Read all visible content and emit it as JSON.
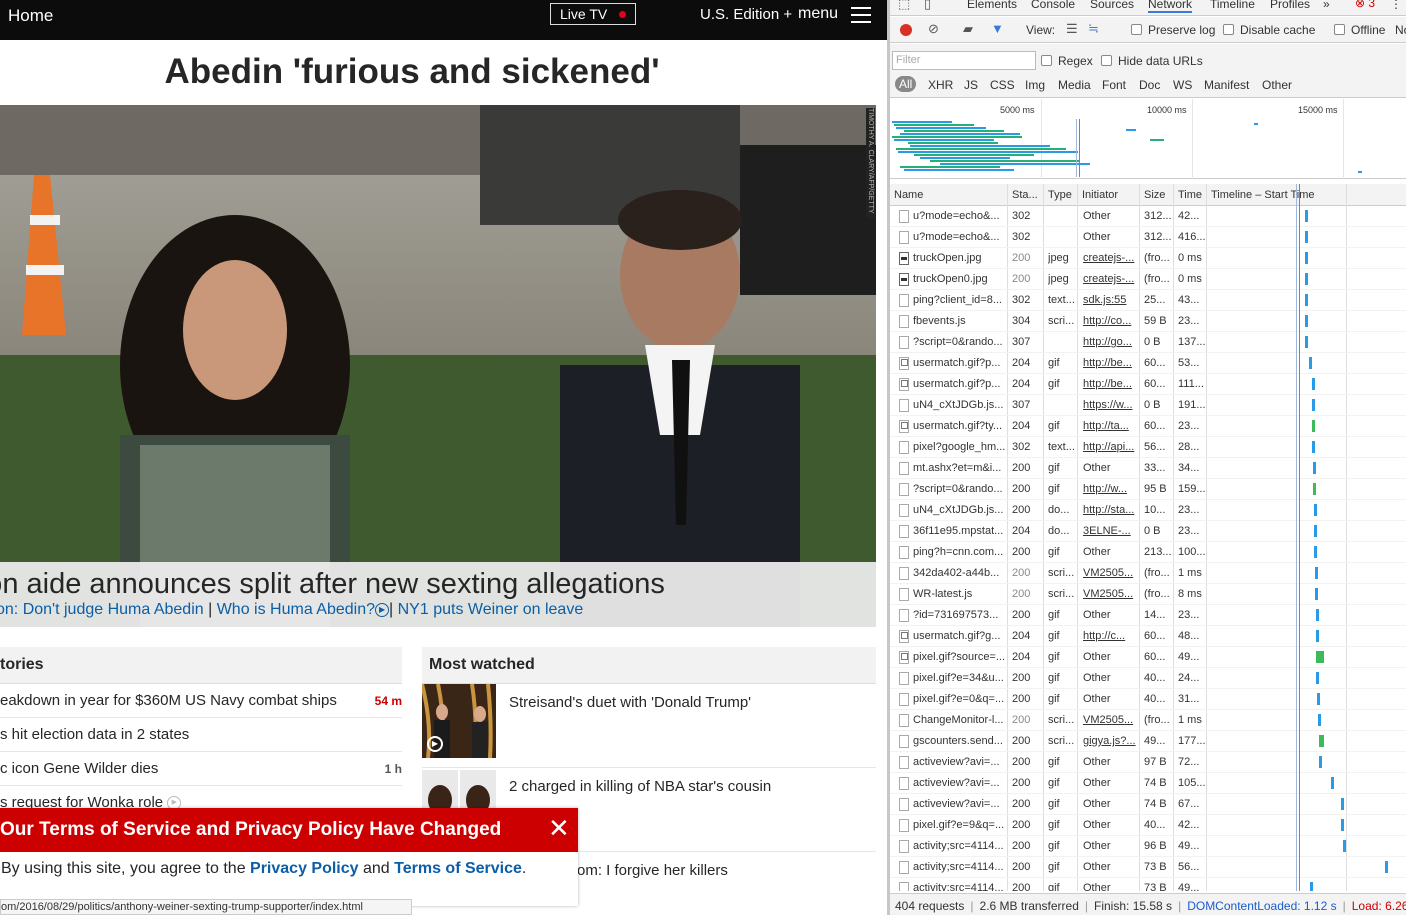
{
  "cnn": {
    "nav": {
      "home": "Home",
      "live_tv": "Live TV",
      "edition": "U.S. Edition",
      "plus": "+",
      "menu": "menu"
    },
    "headline": "Abedin 'furious and sickened'",
    "photo_credit": "TIMOTHY A. CLARY/AFP/GETTY IMAGES",
    "caption": {
      "title": "nton aide announces split after new sexting allegations",
      "link1": "on: Don't judge Huma Abedin",
      "link2": "Who is Huma Abedin?",
      "link3": "NY1 puts Weiner on leave",
      "sep": "|"
    },
    "top_stories": {
      "title": "tories",
      "items": [
        {
          "text": "eakdown in year for $360M US Navy combat ships",
          "time": "54 m"
        },
        {
          "text": "s hit election data in 2 states",
          "time": ""
        },
        {
          "text": "c icon Gene Wilder dies",
          "time": "1 h"
        },
        {
          "text": "s request for Wonka role",
          "time": ""
        }
      ]
    },
    "most_watched": {
      "title": "Most watched",
      "items": [
        {
          "text": "Streisand's duet with 'Donald Trump'"
        },
        {
          "text": "2 charged in killing of NBA star's cousin"
        },
        {
          "text": "om: I forgive her killers"
        }
      ]
    },
    "tos": {
      "title": "Our Terms of Service and Privacy Policy Have Changed",
      "body_prefix": "By using this site, you agree to the ",
      "privacy": "Privacy Policy",
      "and": " and ",
      "terms": "Terms of Service",
      "suffix": ".",
      "close": "✕"
    },
    "status_url": "om/2016/08/29/politics/anthony-weiner-sexting-trump-supporter/index.html"
  },
  "devtools": {
    "tabs": [
      "Elements",
      "Console",
      "Sources",
      "Network",
      "Timeline",
      "Profiles"
    ],
    "active_tab": "Network",
    "more": "»",
    "error_count": "3",
    "toolbar": {
      "view": "View:",
      "preserve_log": "Preserve log",
      "disable_cache": "Disable cache",
      "offline": "Offline",
      "throttle": "No"
    },
    "filter_placeholder": "Filter",
    "regex": "Regex",
    "hide_data_urls": "Hide data URLs",
    "types": [
      "All",
      "XHR",
      "JS",
      "CSS",
      "Img",
      "Media",
      "Font",
      "Doc",
      "WS",
      "Manifest",
      "Other"
    ],
    "overview_labels": [
      "5000 ms",
      "10000 ms",
      "15000 ms"
    ],
    "columns": [
      "Name",
      "Sta...",
      "Type",
      "Initiator",
      "Size",
      "Time",
      "Timeline – Start Time"
    ],
    "rows": [
      {
        "name": "u?mode=echo&...",
        "status": "302",
        "type": "",
        "initiator": "Other",
        "size": "312...",
        "time": "42...",
        "link": false,
        "icon": "doc"
      },
      {
        "name": "u?mode=echo&...",
        "status": "302",
        "type": "",
        "initiator": "Other",
        "size": "312...",
        "time": "416...",
        "link": false,
        "icon": "doc"
      },
      {
        "name": "truckOpen.jpg",
        "status": "200",
        "type": "jpeg",
        "initiator": "createjs-...",
        "size": "(fro...",
        "time": "0 ms",
        "link": true,
        "icon": "img"
      },
      {
        "name": "truckOpen0.jpg",
        "status": "200",
        "type": "jpeg",
        "initiator": "createjs-...",
        "size": "(fro...",
        "time": "0 ms",
        "link": true,
        "icon": "img"
      },
      {
        "name": "ping?client_id=8...",
        "status": "302",
        "type": "text...",
        "initiator": "sdk.js:55",
        "size": "25...",
        "time": "43...",
        "link": true,
        "icon": "doc"
      },
      {
        "name": "fbevents.js",
        "status": "304",
        "type": "scri...",
        "initiator": "http://co...",
        "size": "59 B",
        "time": "23...",
        "link": true,
        "icon": "doc"
      },
      {
        "name": "?script=0&rando...",
        "status": "307",
        "type": "",
        "initiator": "http://go...",
        "size": "0 B",
        "time": "137...",
        "link": true,
        "icon": "doc"
      },
      {
        "name": "usermatch.gif?p...",
        "status": "204",
        "type": "gif",
        "initiator": "http://be...",
        "size": "60...",
        "time": "53...",
        "link": true,
        "icon": "gif"
      },
      {
        "name": "usermatch.gif?p...",
        "status": "204",
        "type": "gif",
        "initiator": "http://be...",
        "size": "60...",
        "time": "111...",
        "link": true,
        "icon": "gif"
      },
      {
        "name": "uN4_cXtJDGb.js...",
        "status": "307",
        "type": "",
        "initiator": "https://w...",
        "size": "0 B",
        "time": "191...",
        "link": true,
        "icon": "doc"
      },
      {
        "name": "usermatch.gif?ty...",
        "status": "204",
        "type": "gif",
        "initiator": "http://ta...",
        "size": "60...",
        "time": "23...",
        "link": true,
        "icon": "gif"
      },
      {
        "name": "pixel?google_hm...",
        "status": "302",
        "type": "text...",
        "initiator": "http://api...",
        "size": "56...",
        "time": "28...",
        "link": true,
        "icon": "doc"
      },
      {
        "name": "mt.ashx?et=m&i...",
        "status": "200",
        "type": "gif",
        "initiator": "Other",
        "size": "33...",
        "time": "34...",
        "link": false,
        "icon": "doc"
      },
      {
        "name": "?script=0&rando...",
        "status": "200",
        "type": "gif",
        "initiator": "http://w...",
        "size": "95 B",
        "time": "159...",
        "link": true,
        "icon": "doc"
      },
      {
        "name": "uN4_cXtJDGb.js...",
        "status": "200",
        "type": "do...",
        "initiator": "http://sta...",
        "size": "10...",
        "time": "23...",
        "link": true,
        "icon": "doc"
      },
      {
        "name": "36f11e95.mpstat...",
        "status": "204",
        "type": "do...",
        "initiator": "3ELNE-...",
        "size": "0 B",
        "time": "23...",
        "link": true,
        "icon": "doc"
      },
      {
        "name": "ping?h=cnn.com...",
        "status": "200",
        "type": "gif",
        "initiator": "Other",
        "size": "213...",
        "time": "100...",
        "link": false,
        "icon": "doc"
      },
      {
        "name": "342da402-a44b...",
        "status": "200",
        "type": "scri...",
        "initiator": "VM2505...",
        "size": "(fro...",
        "time": "1 ms",
        "link": true,
        "icon": "doc"
      },
      {
        "name": "WR-latest.js",
        "status": "200",
        "type": "scri...",
        "initiator": "VM2505...",
        "size": "(fro...",
        "time": "8 ms",
        "link": true,
        "icon": "doc"
      },
      {
        "name": "?id=731697573...",
        "status": "200",
        "type": "gif",
        "initiator": "Other",
        "size": "14...",
        "time": "23...",
        "link": false,
        "icon": "doc"
      },
      {
        "name": "usermatch.gif?g...",
        "status": "204",
        "type": "gif",
        "initiator": "http://c...",
        "size": "60...",
        "time": "48...",
        "link": true,
        "icon": "gif"
      },
      {
        "name": "pixel.gif?source=...",
        "status": "204",
        "type": "gif",
        "initiator": "Other",
        "size": "60...",
        "time": "49...",
        "link": false,
        "icon": "gif"
      },
      {
        "name": "pixel.gif?e=34&u...",
        "status": "200",
        "type": "gif",
        "initiator": "Other",
        "size": "40...",
        "time": "24...",
        "link": false,
        "icon": "doc"
      },
      {
        "name": "pixel.gif?e=0&q=...",
        "status": "200",
        "type": "gif",
        "initiator": "Other",
        "size": "40...",
        "time": "31...",
        "link": false,
        "icon": "doc"
      },
      {
        "name": "ChangeMonitor-l...",
        "status": "200",
        "type": "scri...",
        "initiator": "VM2505...",
        "size": "(fro...",
        "time": "1 ms",
        "link": true,
        "icon": "doc"
      },
      {
        "name": "gscounters.send...",
        "status": "200",
        "type": "scri...",
        "initiator": "gigya.js?...",
        "size": "49...",
        "time": "177...",
        "link": true,
        "icon": "doc"
      },
      {
        "name": "activeview?avi=...",
        "status": "200",
        "type": "gif",
        "initiator": "Other",
        "size": "97 B",
        "time": "72...",
        "link": false,
        "icon": "doc"
      },
      {
        "name": "activeview?avi=...",
        "status": "200",
        "type": "gif",
        "initiator": "Other",
        "size": "74 B",
        "time": "105...",
        "link": false,
        "icon": "doc"
      },
      {
        "name": "activeview?avi=...",
        "status": "200",
        "type": "gif",
        "initiator": "Other",
        "size": "74 B",
        "time": "67...",
        "link": false,
        "icon": "doc"
      },
      {
        "name": "pixel.gif?e=9&q=...",
        "status": "200",
        "type": "gif",
        "initiator": "Other",
        "size": "40...",
        "time": "42...",
        "link": false,
        "icon": "doc"
      },
      {
        "name": "activity;src=4114...",
        "status": "200",
        "type": "gif",
        "initiator": "Other",
        "size": "96 B",
        "time": "49...",
        "link": false,
        "icon": "doc"
      },
      {
        "name": "activity;src=4114...",
        "status": "200",
        "type": "gif",
        "initiator": "Other",
        "size": "73 B",
        "time": "56...",
        "link": false,
        "icon": "doc"
      },
      {
        "name": "activity;src=4114...",
        "status": "200",
        "type": "gif",
        "initiator": "Other",
        "size": "73 B",
        "time": "49...",
        "link": false,
        "icon": "doc"
      }
    ],
    "footer": {
      "requests": "404 requests",
      "transferred": "2.6 MB transferred",
      "finish": "Finish: 15.58 s",
      "dcl": "DOMContentLoaded: 1.12 s",
      "load": "Load: 6.26 s"
    }
  }
}
